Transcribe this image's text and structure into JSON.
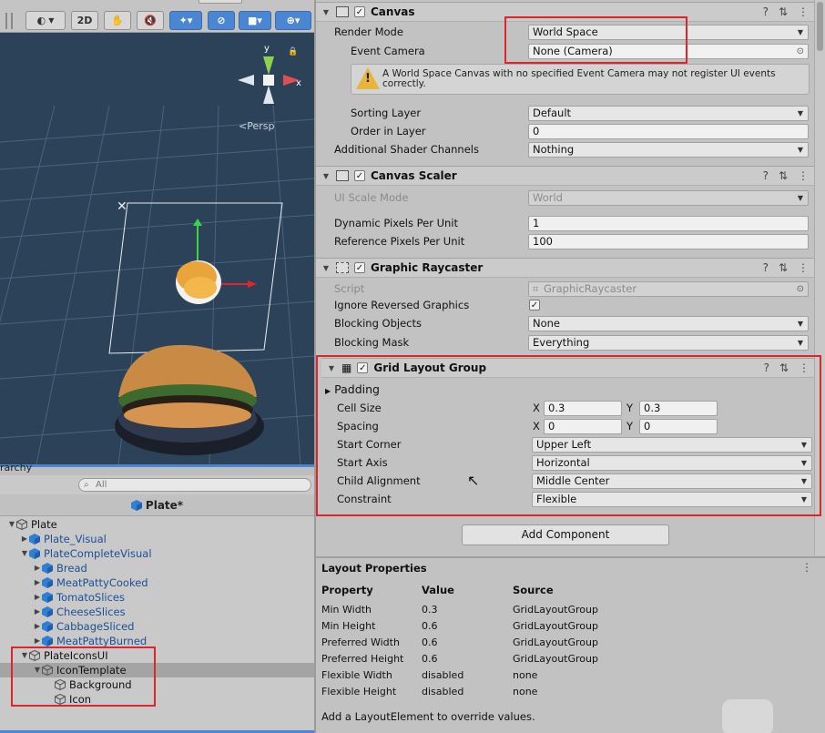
{
  "scene": {
    "toolbar": {
      "mode_2d": "2D",
      "persp_label": "Persp"
    },
    "gizmo": {
      "y": "y",
      "x": "x"
    }
  },
  "hierarchy": {
    "tab_label": "rarchy",
    "search_placeholder": "All",
    "header_title": "Plate*",
    "items": [
      {
        "label": "Plate",
        "depth": 0,
        "expanded": true,
        "kind": "plain"
      },
      {
        "label": "Plate_Visual",
        "depth": 1,
        "expanded": false,
        "kind": "prefab"
      },
      {
        "label": "PlateCompleteVisual",
        "depth": 1,
        "expanded": true,
        "kind": "prefab"
      },
      {
        "label": "Bread",
        "depth": 2,
        "expanded": false,
        "kind": "prefab"
      },
      {
        "label": "MeatPattyCooked",
        "depth": 2,
        "expanded": false,
        "kind": "prefab"
      },
      {
        "label": "TomatoSlices",
        "depth": 2,
        "expanded": false,
        "kind": "prefab"
      },
      {
        "label": "CheeseSlices",
        "depth": 2,
        "expanded": false,
        "kind": "prefab"
      },
      {
        "label": "CabbageSliced",
        "depth": 2,
        "expanded": false,
        "kind": "prefab"
      },
      {
        "label": "MeatPattyBurned",
        "depth": 2,
        "expanded": false,
        "kind": "prefab"
      },
      {
        "label": "PlateIconsUI",
        "depth": 1,
        "expanded": true,
        "kind": "plain"
      },
      {
        "label": "IconTemplate",
        "depth": 2,
        "expanded": true,
        "kind": "plain",
        "selected": true
      },
      {
        "label": "Background",
        "depth": 3,
        "expanded": null,
        "kind": "plain"
      },
      {
        "label": "Icon",
        "depth": 3,
        "expanded": null,
        "kind": "plain"
      }
    ]
  },
  "canvas": {
    "title": "Canvas",
    "render_mode_label": "Render Mode",
    "render_mode_value": "World Space",
    "event_camera_label": "Event Camera",
    "event_camera_value": "None (Camera)",
    "warning": "A World Space Canvas with no specified Event Camera may not register UI events correctly.",
    "sorting_layer_label": "Sorting Layer",
    "sorting_layer_value": "Default",
    "order_in_layer_label": "Order in Layer",
    "order_in_layer_value": "0",
    "shader_channels_label": "Additional Shader Channels",
    "shader_channels_value": "Nothing"
  },
  "canvas_scaler": {
    "title": "Canvas Scaler",
    "ui_scale_mode_label": "UI Scale Mode",
    "ui_scale_mode_value": "World",
    "dynamic_ppu_label": "Dynamic Pixels Per Unit",
    "dynamic_ppu_value": "1",
    "reference_ppu_label": "Reference Pixels Per Unit",
    "reference_ppu_value": "100"
  },
  "graphic_raycaster": {
    "title": "Graphic Raycaster",
    "script_label": "Script",
    "script_value": "GraphicRaycaster",
    "ignore_reversed_label": "Ignore Reversed Graphics",
    "ignore_reversed_checked": "✓",
    "blocking_objects_label": "Blocking Objects",
    "blocking_objects_value": "None",
    "blocking_mask_label": "Blocking Mask",
    "blocking_mask_value": "Everything"
  },
  "grid_layout": {
    "title": "Grid Layout Group",
    "padding_label": "Padding",
    "cell_size_label": "Cell Size",
    "cell_size_x": "0.3",
    "cell_size_y": "0.3",
    "spacing_label": "Spacing",
    "spacing_x": "0",
    "spacing_y": "0",
    "x_label": "X",
    "y_label": "Y",
    "start_corner_label": "Start Corner",
    "start_corner_value": "Upper Left",
    "start_axis_label": "Start Axis",
    "start_axis_value": "Horizontal",
    "child_alignment_label": "Child Alignment",
    "child_alignment_value": "Middle Center",
    "constraint_label": "Constraint",
    "constraint_value": "Flexible"
  },
  "add_component_label": "Add Component",
  "layout_properties": {
    "title": "Layout Properties",
    "columns": [
      "Property",
      "Value",
      "Source"
    ],
    "rows": [
      [
        "Min Width",
        "0.3",
        "GridLayoutGroup"
      ],
      [
        "Min Height",
        "0.6",
        "GridLayoutGroup"
      ],
      [
        "Preferred Width",
        "0.6",
        "GridLayoutGroup"
      ],
      [
        "Preferred Height",
        "0.6",
        "GridLayoutGroup"
      ],
      [
        "Flexible Width",
        "disabled",
        "none"
      ],
      [
        "Flexible Height",
        "disabled",
        "none"
      ]
    ],
    "note": "Add a LayoutElement to override values."
  },
  "colors": {
    "highlight_box": "#e0242e",
    "prefab_text": "#1d4f95",
    "prefab_cube": "#2f7fd6",
    "toolbar_active": "#4a86d1",
    "scene_bg": "#2c4258"
  }
}
